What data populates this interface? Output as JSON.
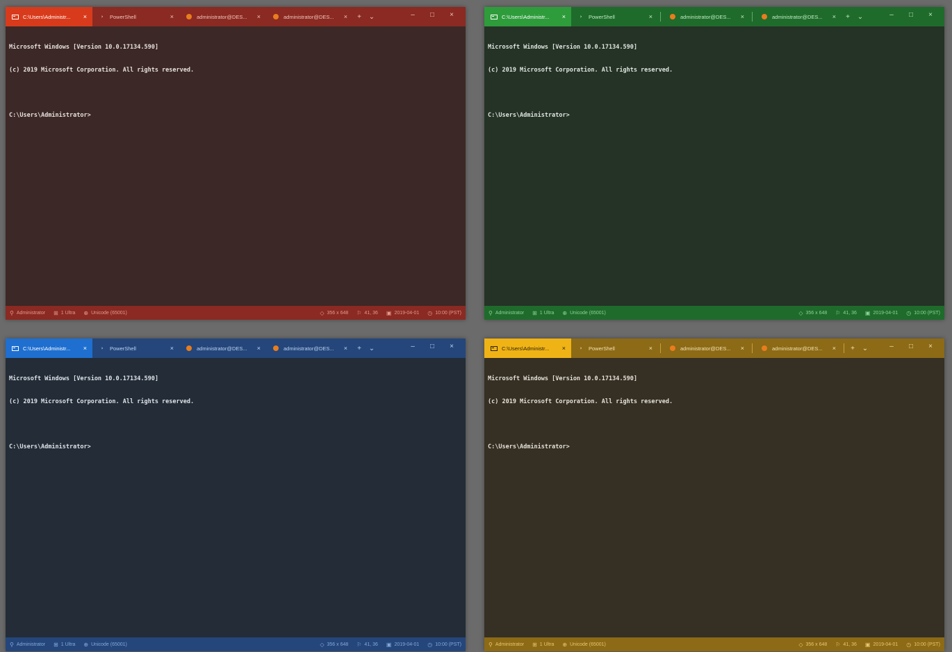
{
  "windows": [
    {
      "theme": "red",
      "accent": "#d83b1c",
      "tabs": [
        {
          "label": "C:\\Users\\Administr...",
          "icon": "cmd-icon"
        },
        {
          "label": "PowerShell",
          "icon": "powershell-icon"
        },
        {
          "label": "administrator@DES...",
          "icon": "ubuntu-icon"
        },
        {
          "label": "administrator@DES...",
          "icon": "ubuntu-icon"
        }
      ],
      "console": [
        "Microsoft Windows [Version 10.0.17134.590]",
        "(c) 2019 Microsoft Corporation. All rights reserved.",
        "C:\\Users\\Administrator>"
      ],
      "status_left": [
        "Administrator",
        "1 Ultra",
        "Unicode (65001)"
      ],
      "status_right": [
        "356 x 648",
        "41, 36",
        "2019-04-01",
        "10:00 (PST)"
      ]
    },
    {
      "theme": "green",
      "accent": "#2e9c3b",
      "tabs": [
        {
          "label": "C:\\Users\\Administr...",
          "icon": "cmd-icon"
        },
        {
          "label": "PowerShell",
          "icon": "powershell-icon"
        },
        {
          "label": "administrator@DES...",
          "icon": "ubuntu-icon"
        },
        {
          "label": "administrator@DES...",
          "icon": "ubuntu-icon"
        }
      ],
      "console": [
        "Microsoft Windows [Version 10.0.17134.590]",
        "(c) 2019 Microsoft Corporation. All rights reserved.",
        "C:\\Users\\Administrator>"
      ],
      "status_left": [
        "Administrator",
        "1 Ultra",
        "Unicode (65001)"
      ],
      "status_right": [
        "356 x 648",
        "41, 36",
        "2019-04-01",
        "10:00 (PST)"
      ]
    },
    {
      "theme": "blue",
      "accent": "#1e6fd0",
      "tabs": [
        {
          "label": "C:\\Users\\Administr...",
          "icon": "cmd-icon"
        },
        {
          "label": "PowerShell",
          "icon": "powershell-icon"
        },
        {
          "label": "administrator@DES...",
          "icon": "ubuntu-icon"
        },
        {
          "label": "administrator@DES...",
          "icon": "ubuntu-icon"
        }
      ],
      "console": [
        "Microsoft Windows [Version 10.0.17134.590]",
        "(c) 2019 Microsoft Corporation. All rights reserved.",
        "C:\\Users\\Administrator>"
      ],
      "status_left": [
        "Administrator",
        "1 Ultra",
        "Unicode (65001)"
      ],
      "status_right": [
        "356 x 648",
        "41, 36",
        "2019-04-01",
        "10:00 (PST)"
      ]
    },
    {
      "theme": "yellow",
      "accent": "#f0b316",
      "tabs": [
        {
          "label": "C:\\Users\\Administr...",
          "icon": "cmd-icon"
        },
        {
          "label": "PowerShell",
          "icon": "powershell-icon"
        },
        {
          "label": "administrator@DES...",
          "icon": "ubuntu-icon"
        },
        {
          "label": "administrator@DES...",
          "icon": "ubuntu-icon"
        }
      ],
      "console": [
        "Microsoft Windows [Version 10.0.17134.590]",
        "(c) 2019 Microsoft Corporation. All rights reserved.",
        "C:\\Users\\Administrator>"
      ],
      "status_left": [
        "Administrator",
        "1 Ultra",
        "Unicode (65001)"
      ],
      "status_right": [
        "356 x 648",
        "41, 36",
        "2019-04-01",
        "10:00 (PST)"
      ]
    }
  ],
  "glyphs": {
    "tab_close": "×",
    "new_tab": "+",
    "dropdown": "⌄",
    "minimize": "–",
    "maximize": "□",
    "close": "×"
  }
}
